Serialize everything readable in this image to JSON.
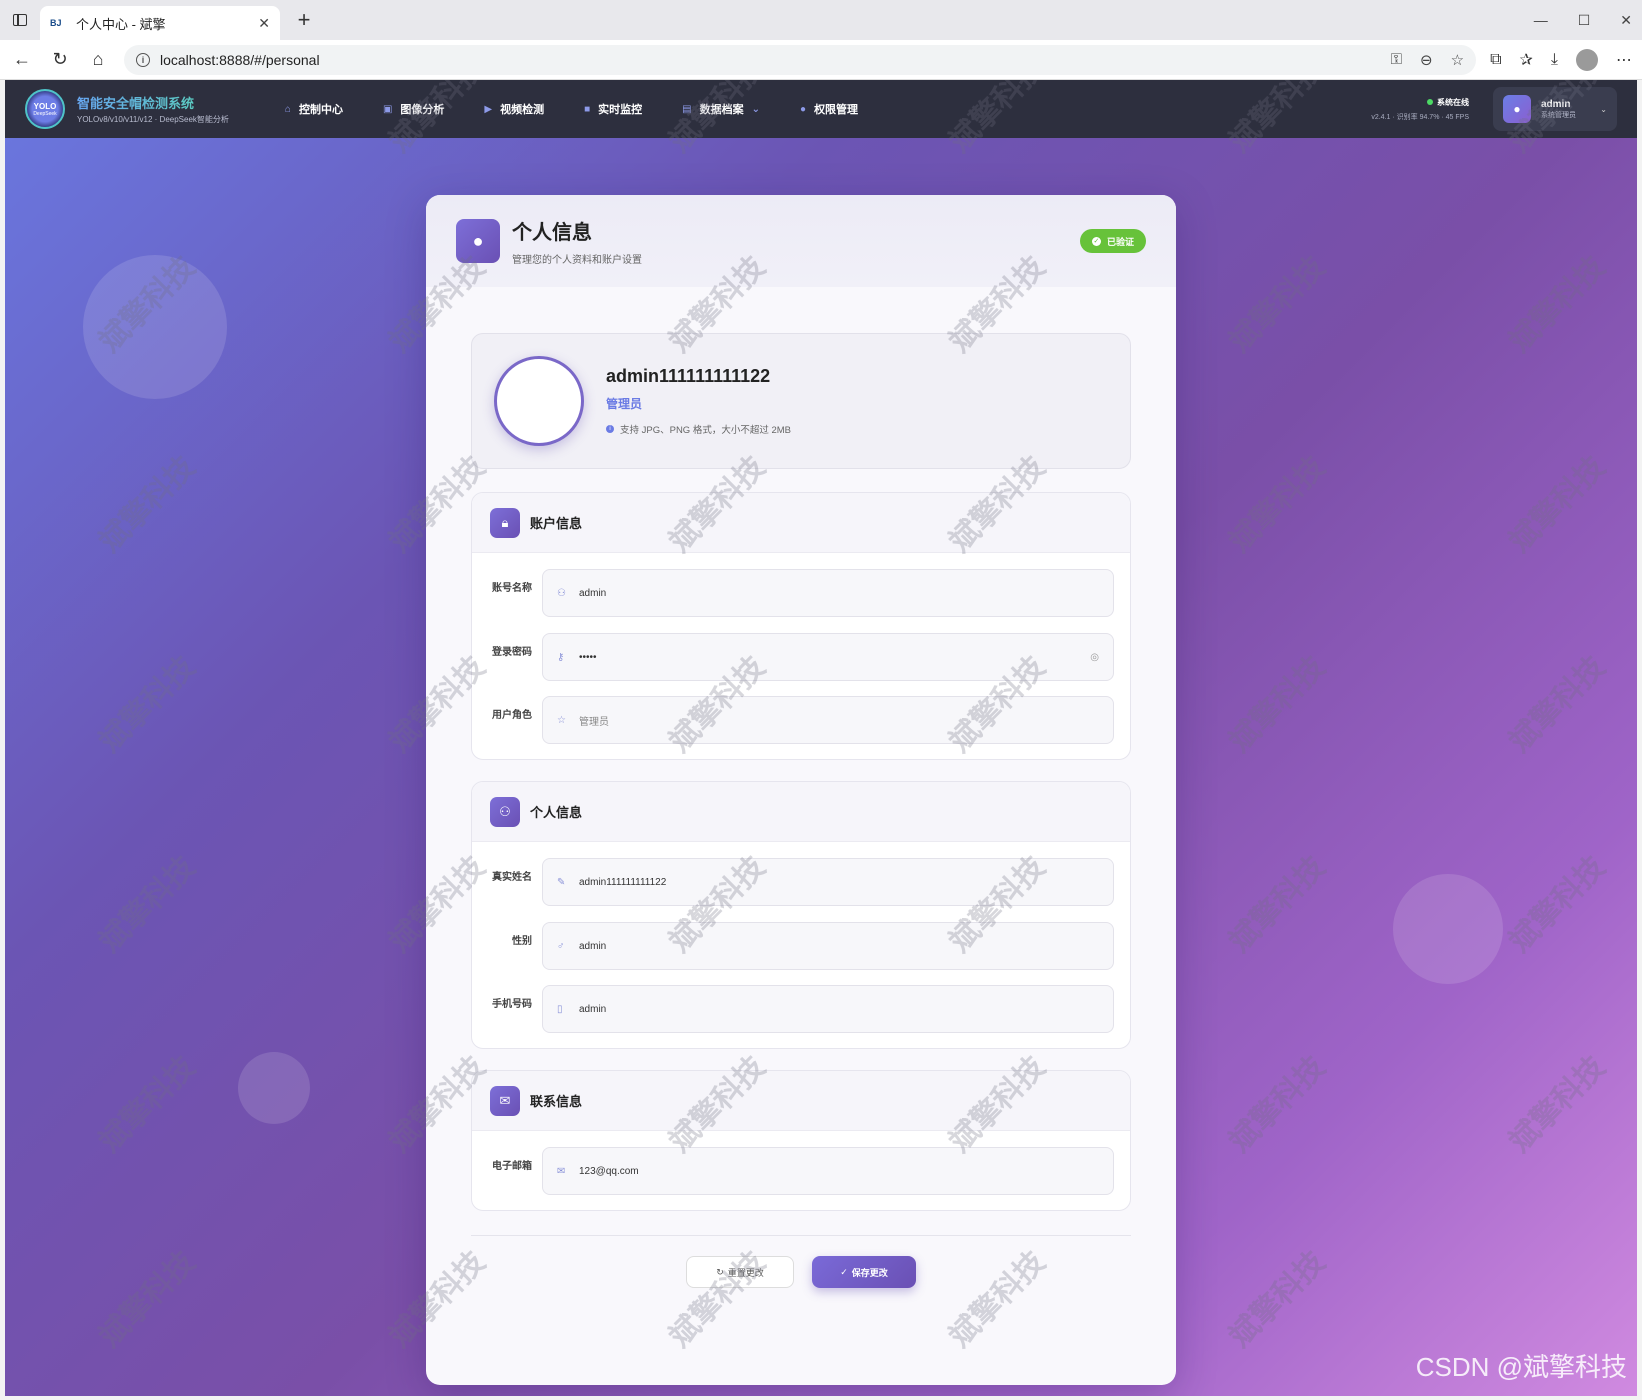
{
  "browser": {
    "tab_favicon": "BJ",
    "tab_title": "个人中心 - 斌擎",
    "tab_close": "✕",
    "new_tab": "+",
    "url": "localhost:8888/#/personal",
    "window_controls": [
      "—",
      "☐",
      "✕"
    ]
  },
  "app": {
    "logo_text": "YOLO",
    "logo_sub": "DeepSeek",
    "brand_title": "智能安全帽检测系统",
    "brand_sub": "YOLOv8/v10/v11/v12 · DeepSeek智能分析",
    "menu": [
      {
        "label": "控制中心",
        "icon": "home-icon"
      },
      {
        "label": "图像分析",
        "icon": "image-icon"
      },
      {
        "label": "视频检测",
        "icon": "video-icon"
      },
      {
        "label": "实时监控",
        "icon": "camera-icon"
      },
      {
        "label": "数据档案",
        "icon": "file-icon"
      },
      {
        "label": "权限管理",
        "icon": "user-icon"
      }
    ],
    "status_online": "系统在线",
    "status_detail": "v2.4.1 · 识别率 94.7% · 45 FPS",
    "user_name": "admin",
    "user_role": "系统管理员"
  },
  "card": {
    "title": "个人信息",
    "subtitle": "管理您的个人资料和账户设置",
    "verified_label": "已验证",
    "profile": {
      "name": "admin111111111122",
      "role": "管理员",
      "hint": "支持 JPG、PNG 格式，大小不超过 2MB"
    },
    "account_section": {
      "title": "账户信息",
      "fields": [
        {
          "label": "账号名称",
          "value": "admin"
        },
        {
          "label": "登录密码",
          "value": "•••••"
        },
        {
          "label": "用户角色",
          "value": "管理员"
        }
      ]
    },
    "personal_section": {
      "title": "个人信息",
      "fields": [
        {
          "label": "真实姓名",
          "value": "admin111111111122"
        },
        {
          "label": "性别",
          "value": "admin"
        },
        {
          "label": "手机号码",
          "value": "admin"
        }
      ]
    },
    "contact_section": {
      "title": "联系信息",
      "fields": [
        {
          "label": "电子邮箱",
          "value": "123@qq.com"
        }
      ]
    },
    "reset_label": "重置更改",
    "save_label": "保存更改"
  },
  "watermark_text": "斌擎科技",
  "csdn_text": "CSDN @斌擎科技",
  "colors": {
    "accent": "#6a50b4",
    "nav_bg": "#2d2f3e",
    "verified": "#67c23a"
  }
}
